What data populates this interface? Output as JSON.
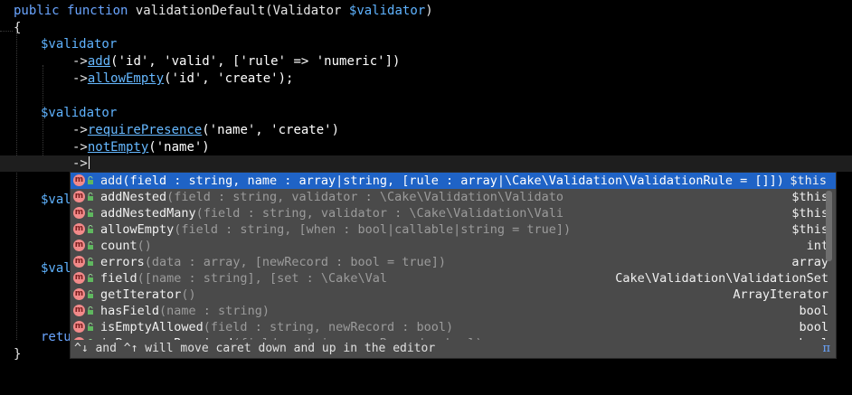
{
  "editor": {
    "lines": {
      "l1_kw": "public function ",
      "l1_fn": "validationDefault",
      "l1_rest_open": "(",
      "l1_type": "Validator ",
      "l1_param": "$validator",
      "l1_close": ")",
      "l2": "{",
      "l3": "$validator",
      "l4_arrow": "->",
      "l4_method": "add",
      "l4_args": "('id', 'valid', ['rule' => 'numeric'])",
      "l5_arrow": "->",
      "l5_method": "allowEmpty",
      "l5_args": "('id', 'create');",
      "l7": "$validator",
      "l8_arrow": "->",
      "l8_method": "requirePresence",
      "l8_args": "('name', 'create')",
      "l9_arrow": "->",
      "l9_method": "notEmpty",
      "l9_args": "('name')",
      "l10_arrow": "->",
      "l12_partial": "$val",
      "l16_partial": "$val",
      "l20_partial": "retu",
      "l21": "}"
    }
  },
  "completion": {
    "items": [
      {
        "name": "add",
        "params": "(field : string, name : array|string, [rule : array|\\Cake\\Validation\\ValidationRule = []])",
        "ret": "$this"
      },
      {
        "name": "addNested",
        "params": "(field : string, validator : \\Cake\\Validation\\Validato",
        "ret": "$this"
      },
      {
        "name": "addNestedMany",
        "params": "(field : string, validator : \\Cake\\Validation\\Vali",
        "ret": "$this"
      },
      {
        "name": "allowEmpty",
        "params": "(field : string, [when : bool|callable|string = true])",
        "ret": "$this"
      },
      {
        "name": "count",
        "params": "()",
        "ret": "int"
      },
      {
        "name": "errors",
        "params": "(data : array, [newRecord : bool = true])",
        "ret": "array"
      },
      {
        "name": "field",
        "params": "([name : string], [set : \\Cake\\Val",
        "ret": "Cake\\Validation\\ValidationSet"
      },
      {
        "name": "getIterator",
        "params": "()",
        "ret": "ArrayIterator"
      },
      {
        "name": "hasField",
        "params": "(name : string)",
        "ret": "bool"
      },
      {
        "name": "isEmptyAllowed",
        "params": "(field : string, newRecord : bool)",
        "ret": "bool"
      },
      {
        "name": "isPresenceRequired",
        "params": "(field : string, newRecord : bool)",
        "ret": "bool"
      }
    ],
    "icon_letter": "m",
    "footer_hint": "^↓ and ^↑ will move caret down and up in the editor",
    "footer_more": "»",
    "footer_pi": "π"
  }
}
